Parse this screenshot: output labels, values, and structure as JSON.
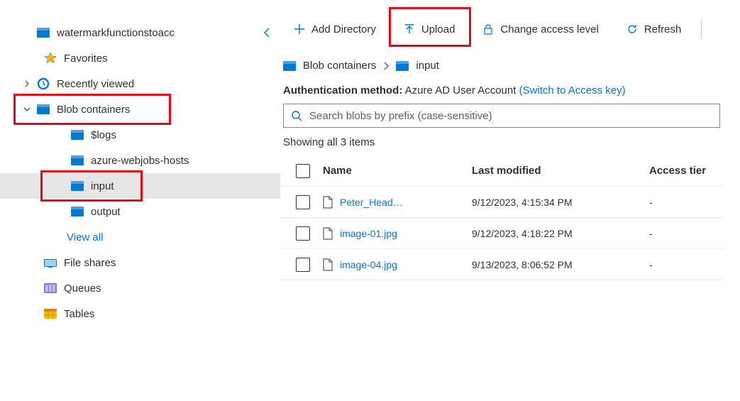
{
  "sidebar": {
    "root_label": "watermarkfunctionstoacc",
    "items": [
      {
        "label": "Favorites"
      },
      {
        "label": "Recently viewed"
      },
      {
        "label": "Blob containers"
      },
      {
        "label": "$logs"
      },
      {
        "label": "azure-webjobs-hosts"
      },
      {
        "label": "input"
      },
      {
        "label": "output"
      },
      {
        "label": "View all"
      },
      {
        "label": "File shares"
      },
      {
        "label": "Queues"
      },
      {
        "label": "Tables"
      }
    ]
  },
  "toolbar": {
    "add_directory": "Add Directory",
    "upload": "Upload",
    "change_access": "Change access level",
    "refresh": "Refresh"
  },
  "breadcrumb": {
    "root": "Blob containers",
    "current": "input"
  },
  "auth": {
    "label": "Authentication method:",
    "value": "Azure AD User Account",
    "switch_link": "(Switch to Access key)"
  },
  "search": {
    "placeholder": "Search blobs by prefix (case-sensitive)"
  },
  "count_text": "Showing all 3 items",
  "table": {
    "headers": {
      "name": "Name",
      "modified": "Last modified",
      "tier": "Access tier"
    },
    "rows": [
      {
        "name": "Peter_Head…",
        "modified": "9/12/2023, 4:15:34 PM",
        "tier": "-"
      },
      {
        "name": "image-01.jpg",
        "modified": "9/12/2023, 4:18:22 PM",
        "tier": "-"
      },
      {
        "name": "image-04.jpg",
        "modified": "9/13/2023, 8:06:52 PM",
        "tier": "-"
      }
    ]
  }
}
